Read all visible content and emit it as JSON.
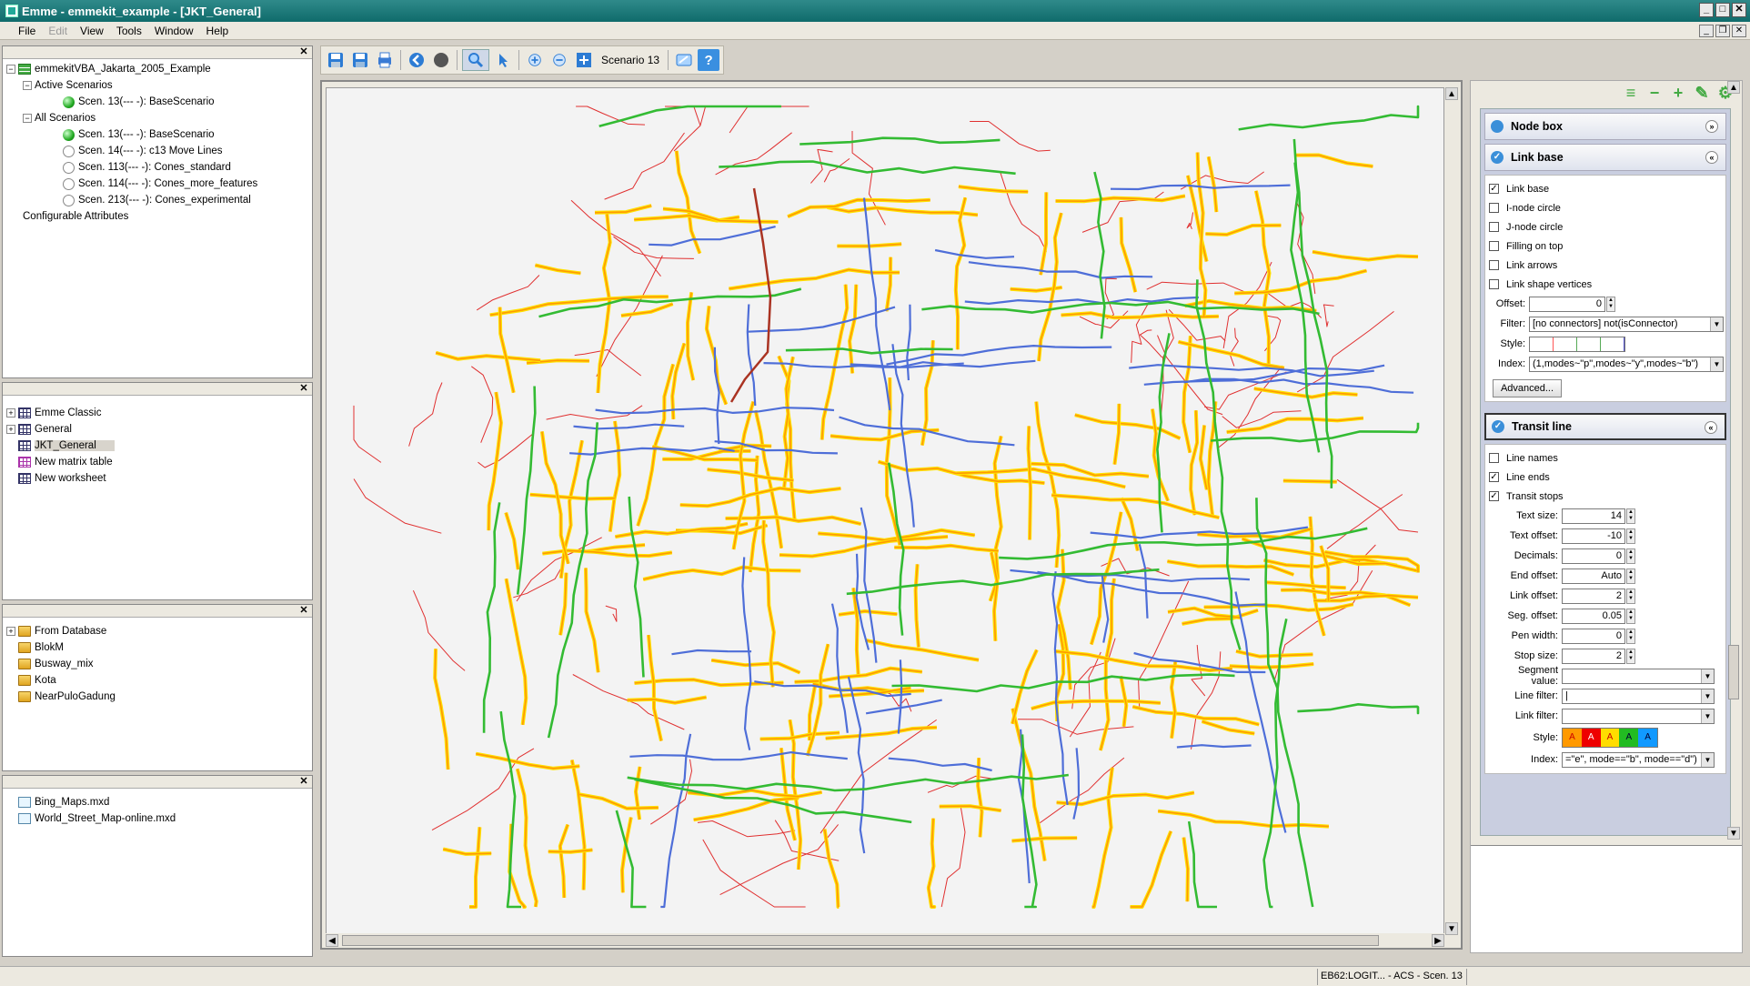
{
  "window": {
    "title": "Emme - emmekit_example - [JKT_General]",
    "buttons": [
      "_",
      "□",
      "✕"
    ],
    "mdi_buttons": [
      "_",
      "❐",
      "✕"
    ]
  },
  "menu": [
    "File",
    "Edit",
    "View",
    "Tools",
    "Window",
    "Help"
  ],
  "panel1": {
    "close": "✕",
    "items": [
      {
        "label": "emmekitVBA_Jakarta_2005_Example"
      },
      {
        "label": "Active Scenarios"
      },
      {
        "label": "Scen. 13(--- -): BaseScenario"
      },
      {
        "label": "All Scenarios"
      },
      {
        "label": "Scen. 13(--- -): BaseScenario"
      },
      {
        "label": "Scen. 14(--- -): c13 Move Lines"
      },
      {
        "label": "Scen. 113(--- -): Cones_standard"
      },
      {
        "label": "Scen. 114(--- -): Cones_more_features"
      },
      {
        "label": "Scen. 213(--- -): Cones_experimental"
      },
      {
        "label": "Configurable Attributes"
      }
    ]
  },
  "panel2": {
    "close": "✕",
    "items": [
      {
        "label": "Emme Classic"
      },
      {
        "label": "General"
      },
      {
        "label": "JKT_General"
      },
      {
        "label": "New matrix table"
      },
      {
        "label": "New worksheet"
      }
    ]
  },
  "panel3": {
    "close": "✕",
    "items": [
      {
        "label": "From Database"
      },
      {
        "label": "BlokM"
      },
      {
        "label": "Busway_mix"
      },
      {
        "label": "Kota"
      },
      {
        "label": "NearPuloGadung"
      }
    ]
  },
  "panel4": {
    "close": "✕",
    "items": [
      {
        "label": "Bing_Maps.mxd"
      },
      {
        "label": "World_Street_Map-online.mxd"
      }
    ]
  },
  "toolbar": {
    "scenario_label": "Scenario 13",
    "help": "?"
  },
  "right": {
    "node_box": {
      "title": "Node box",
      "chevron": "»"
    },
    "link_base": {
      "title": "Link base",
      "chevron": "«",
      "checks": [
        {
          "label": "Link base",
          "checked": "✓"
        },
        {
          "label": "I-node circle",
          "checked": ""
        },
        {
          "label": "J-node circle",
          "checked": ""
        },
        {
          "label": "Filling on top",
          "checked": ""
        },
        {
          "label": "Link arrows",
          "checked": ""
        },
        {
          "label": "Link shape vertices",
          "checked": ""
        }
      ],
      "offset_label": "Offset:",
      "offset_value": "0",
      "filter_label": "Filter:",
      "filter_value": "[no connectors] not(isConnector)",
      "style_label": "Style:",
      "index_label": "Index:",
      "index_value": "(1,modes~\"p\",modes~\"y\",modes~\"b\")",
      "advanced": "Advanced..."
    },
    "transit_line": {
      "title": "Transit line",
      "chevron": "«",
      "checks": [
        {
          "label": "Line names",
          "checked": ""
        },
        {
          "label": "Line ends",
          "checked": "✓"
        },
        {
          "label": "Transit stops",
          "checked": "✓"
        }
      ],
      "fields": [
        {
          "label": "Text size:",
          "value": "14"
        },
        {
          "label": "Text offset:",
          "value": "-10"
        },
        {
          "label": "Decimals:",
          "value": "0"
        },
        {
          "label": "End offset:",
          "value": "Auto"
        },
        {
          "label": "Link offset:",
          "value": "2"
        },
        {
          "label": "Seg. offset:",
          "value": "0.05"
        },
        {
          "label": "Pen width:",
          "value": "0"
        },
        {
          "label": "Stop size:",
          "value": "2"
        }
      ],
      "segment_value_label": "Segment value:",
      "segment_value": "",
      "line_filter_label": "Line filter:",
      "line_filter": "|",
      "link_filter_label": "Link filter:",
      "link_filter": "",
      "style_label": "Style:",
      "style_swatch_letter": "A",
      "index_label": "Index:",
      "index_value": "=\"e\", mode==\"b\", mode==\"d\")"
    }
  },
  "status": {
    "text": "EB62:LOGIT... - ACS - Scen. 13"
  },
  "colors": {
    "titlebar": "#0f6b6b",
    "road": "#ff9900",
    "road_edge": "#ffe100",
    "boundary": "#e03030",
    "bus": "#4e6ed8",
    "transit": "#33bb33",
    "rail": "#aa3322"
  }
}
